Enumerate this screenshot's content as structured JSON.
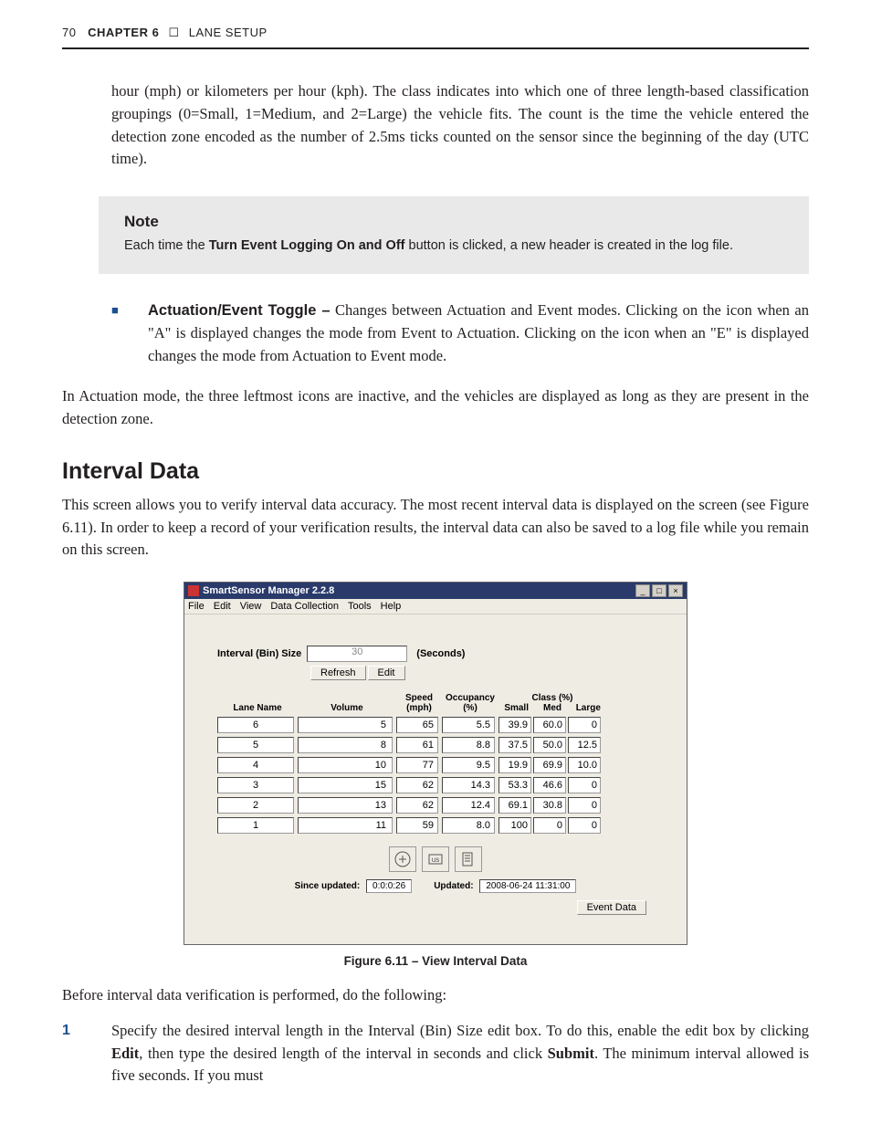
{
  "header": {
    "page_no": "70",
    "chapter_label": "CHAPTER 6",
    "sep": "☐",
    "chapter_title": "LANE SETUP"
  },
  "para_intro": "hour (mph) or kilometers per hour (kph). The class indicates into which one of three length-based classification groupings (0=Small, 1=Medium, and 2=Large) the vehicle fits. The count is the time the vehicle entered the detection zone encoded as the number of 2.5ms ticks counted on the sensor since the beginning of the day (UTC time).",
  "note": {
    "title": "Note",
    "before": "Each time the ",
    "bold": "Turn Event Logging On and Off",
    "after": " button is clicked, a new header is created in the log file."
  },
  "bullet": {
    "label": "Actuation/Event Toggle –",
    "text": " Changes between Actuation and Event modes. Clicking on the icon when an \"A\" is displayed changes the mode from Event to Actuation. Clicking on the icon when an \"E\" is displayed changes the mode from Actuation to Event mode."
  },
  "para_actuation": "In Actuation mode, the three leftmost icons are inactive, and the vehicles are displayed as long as they are present in the detection zone.",
  "section_title": "Interval Data",
  "para_interval": "This screen allows you to verify interval data accuracy. The most recent interval data is displayed on the screen (see Figure 6.11). In order to keep a record of your verification results, the interval data can also be saved to a log file while you remain on this screen.",
  "app": {
    "title": "SmartSensor Manager 2.2.8",
    "menus": [
      "File",
      "Edit",
      "View",
      "Data Collection",
      "Tools",
      "Help"
    ],
    "bin_label": "Interval (Bin) Size",
    "bin_value": "30",
    "bin_unit": "(Seconds)",
    "btn_refresh": "Refresh",
    "btn_edit": "Edit",
    "headers": {
      "lane": "Lane Name",
      "volume": "Volume",
      "speed_l1": "Speed",
      "speed_l2": "(mph)",
      "occ_l1": "Occupancy",
      "occ_l2": "(%)",
      "class_l1": "Class (%)",
      "small": "Small",
      "med": "Med",
      "large": "Large"
    },
    "rows": [
      {
        "lane": "6",
        "vol": "5",
        "spd": "65",
        "occ": "5.5",
        "s": "39.9",
        "m": "60.0",
        "l": "0"
      },
      {
        "lane": "5",
        "vol": "8",
        "spd": "61",
        "occ": "8.8",
        "s": "37.5",
        "m": "50.0",
        "l": "12.5"
      },
      {
        "lane": "4",
        "vol": "10",
        "spd": "77",
        "occ": "9.5",
        "s": "19.9",
        "m": "69.9",
        "l": "10.0"
      },
      {
        "lane": "3",
        "vol": "15",
        "spd": "62",
        "occ": "14.3",
        "s": "53.3",
        "m": "46.6",
        "l": "0"
      },
      {
        "lane": "2",
        "vol": "13",
        "spd": "62",
        "occ": "12.4",
        "s": "69.1",
        "m": "30.8",
        "l": "0"
      },
      {
        "lane": "1",
        "vol": "11",
        "spd": "59",
        "occ": "8.0",
        "s": "100",
        "m": "0",
        "l": "0"
      }
    ],
    "since_label": "Since updated:",
    "since_val": "0:0:0:26",
    "updated_label": "Updated:",
    "updated_val": "2008-06-24 11:31:00",
    "event_btn": "Event Data"
  },
  "figure_caption": "Figure 6.11 – View Interval Data",
  "para_before": "Before interval data verification is performed, do the following:",
  "step1": {
    "p1": "Specify the desired interval length in the Interval (Bin) Size edit box. To do this, enable the edit box by clicking ",
    "b1": "Edit",
    "p2": ", then type the desired length of the interval in seconds and click ",
    "b2": "Submit",
    "p3": ". The minimum interval allowed is five seconds. If you must"
  }
}
